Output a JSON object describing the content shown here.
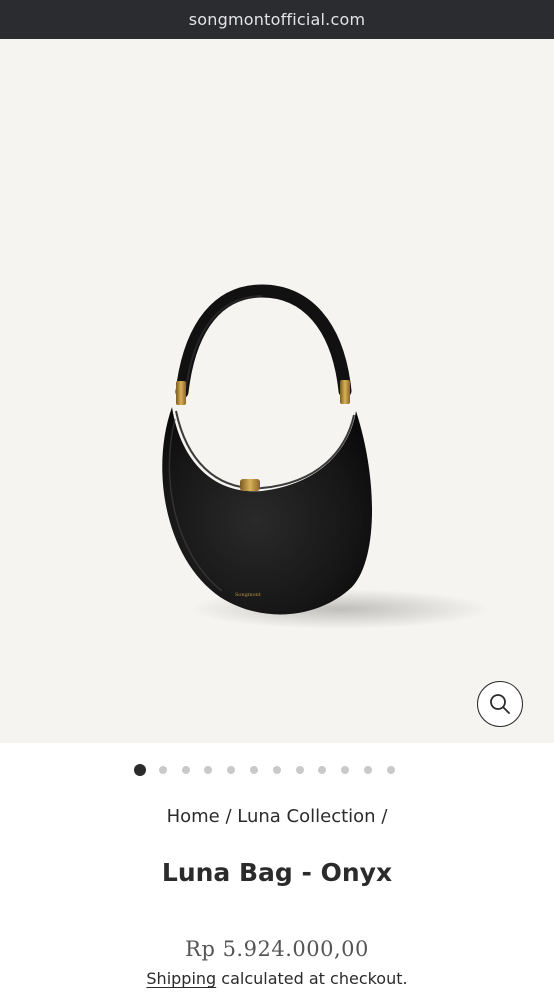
{
  "browser": {
    "url": "songmontofficial.com"
  },
  "gallery": {
    "image_alt": "Luna Bag - Onyx",
    "bag_brand_mark": "Songmont",
    "dot_count": 12,
    "active_index": 0,
    "zoom_icon": "search-icon"
  },
  "breadcrumb": {
    "home": "Home",
    "sep": "/",
    "collection": "Luna Collection"
  },
  "product": {
    "title": "Luna Bag - Onyx",
    "price": "Rp 5.924.000,00",
    "shipping_link": "Shipping",
    "shipping_rest": " calculated at checkout."
  },
  "colors": {
    "url_bar": "#2b2c30",
    "hero_bg": "#f6f4f0",
    "text": "#2b2b2b",
    "dot_active": "#2b2b2b",
    "dot_inactive": "#c9c9c9"
  }
}
